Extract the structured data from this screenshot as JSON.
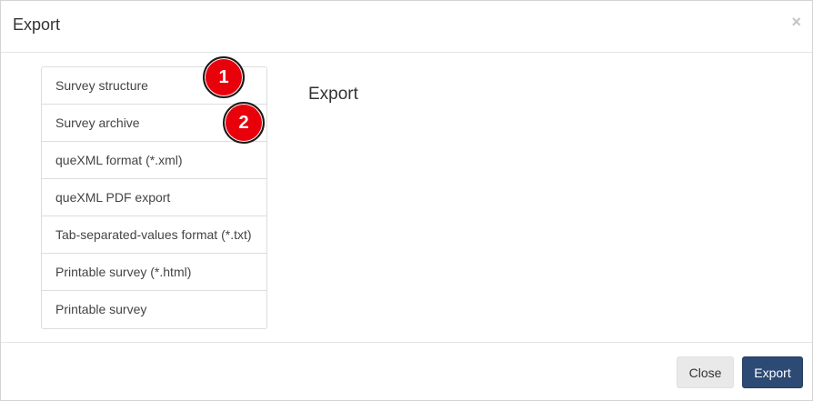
{
  "modal": {
    "title": "Export",
    "close_symbol": "×"
  },
  "export_options": [
    {
      "label": "Survey structure"
    },
    {
      "label": "Survey archive"
    },
    {
      "label": "queXML format (*.xml)"
    },
    {
      "label": "queXML PDF export"
    },
    {
      "label": "Tab-separated-values format (*.txt)"
    },
    {
      "label": "Printable survey (*.html)"
    },
    {
      "label": "Printable survey"
    }
  ],
  "content": {
    "title": "Export"
  },
  "annotations": {
    "marker_1": "1",
    "marker_2": "2"
  },
  "footer": {
    "close_label": "Close",
    "export_label": "Export"
  },
  "colors": {
    "primary_button": "#2c4a74",
    "annotation_marker": "#e8000b"
  }
}
